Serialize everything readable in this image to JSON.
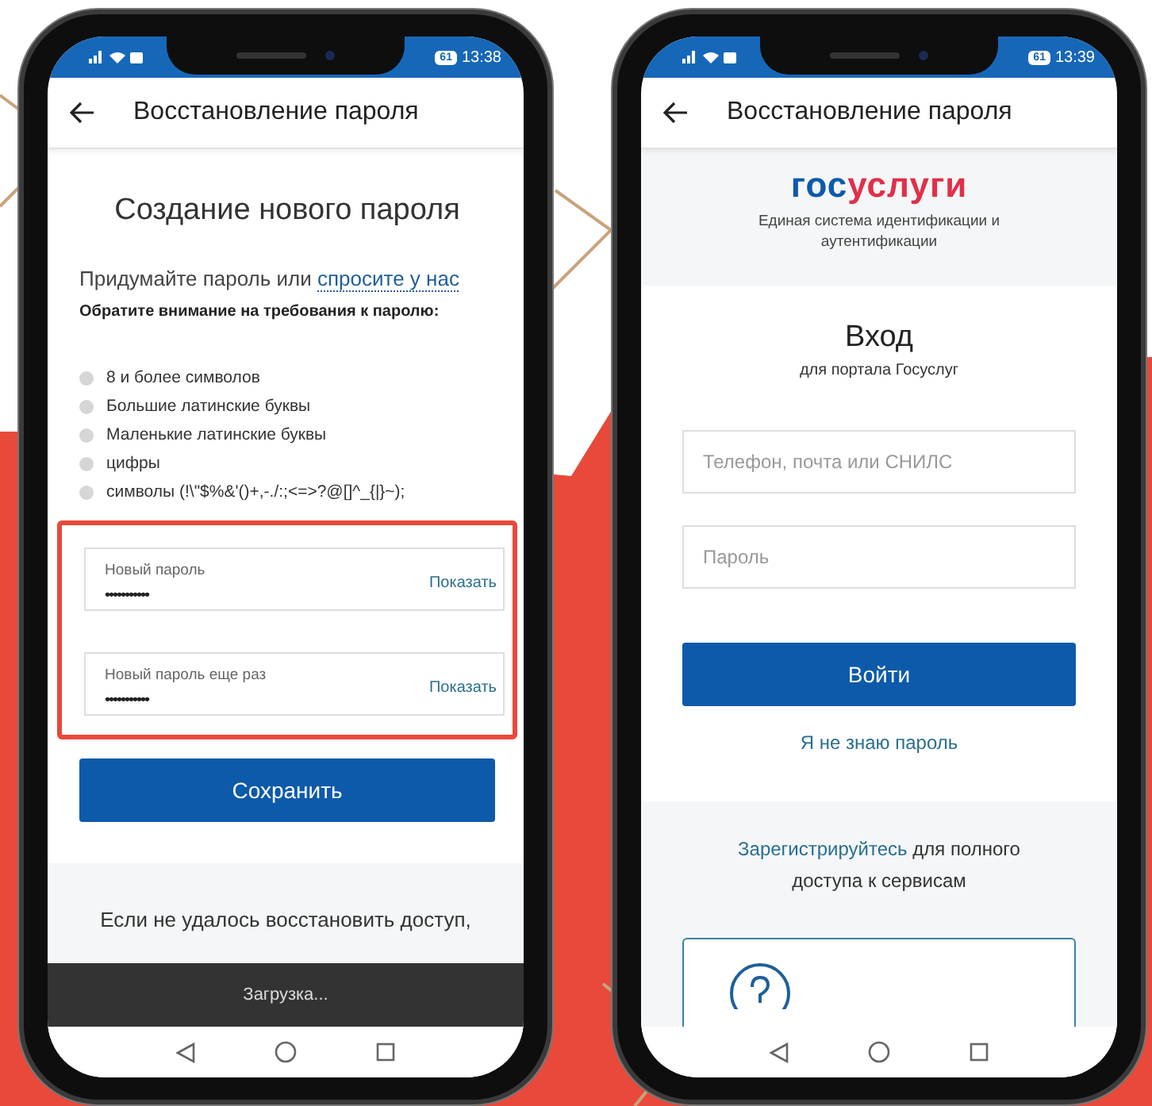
{
  "phones": [
    {
      "kind": "password_reset",
      "status_bar": {
        "battery": "61",
        "time": "13:38"
      },
      "header": {
        "title": "Восстановление пароля"
      },
      "heading": "Создание нового пароля",
      "intro": {
        "text": "Придумайте пароль или",
        "link": "спросите у нас"
      },
      "requirements_title": "Обратите внимание на требования к паролю:",
      "requirements": [
        {
          "text": "8 и более символов",
          "met": false
        },
        {
          "text": "Большие латинские буквы",
          "met": false
        },
        {
          "text": "Маленькие латинские буквы",
          "met": false
        },
        {
          "text": "цифры",
          "met": false
        },
        {
          "text": "символы (!\\\"$%&'()+,-./:;<=>?@[]^_{|}~);",
          "met": false
        }
      ],
      "fields_highlighted": true,
      "fields": [
        {
          "label": "Новый пароль",
          "value": "•••••••••••",
          "action": "Показать"
        },
        {
          "label": "Новый пароль еще раз",
          "value": "•••••••••••",
          "action": "Показать"
        }
      ],
      "save_button": "Сохранить",
      "footer_text": "Если не удалось восстановить доступ,",
      "toast": "Загрузка..."
    },
    {
      "kind": "login",
      "status_bar": {
        "battery": "61",
        "time": "13:39"
      },
      "header": {
        "title": "Восстановление пароля"
      },
      "logo": {
        "part_1": "гос",
        "part_2": "услуги"
      },
      "logo_caption": "Единая система идентификации и аутентификации",
      "title": "Вход",
      "subtitle": "для портала Госуслуг",
      "fields": [
        {
          "placeholder": "Телефон, почта или СНИЛС"
        },
        {
          "placeholder": "Пароль"
        }
      ],
      "login_button": "Войти",
      "forgot_link": "Я не знаю пароль",
      "register": {
        "link": "Зарегистрируйтесь",
        "text": "для полного доступа к сервисам"
      }
    }
  ]
}
